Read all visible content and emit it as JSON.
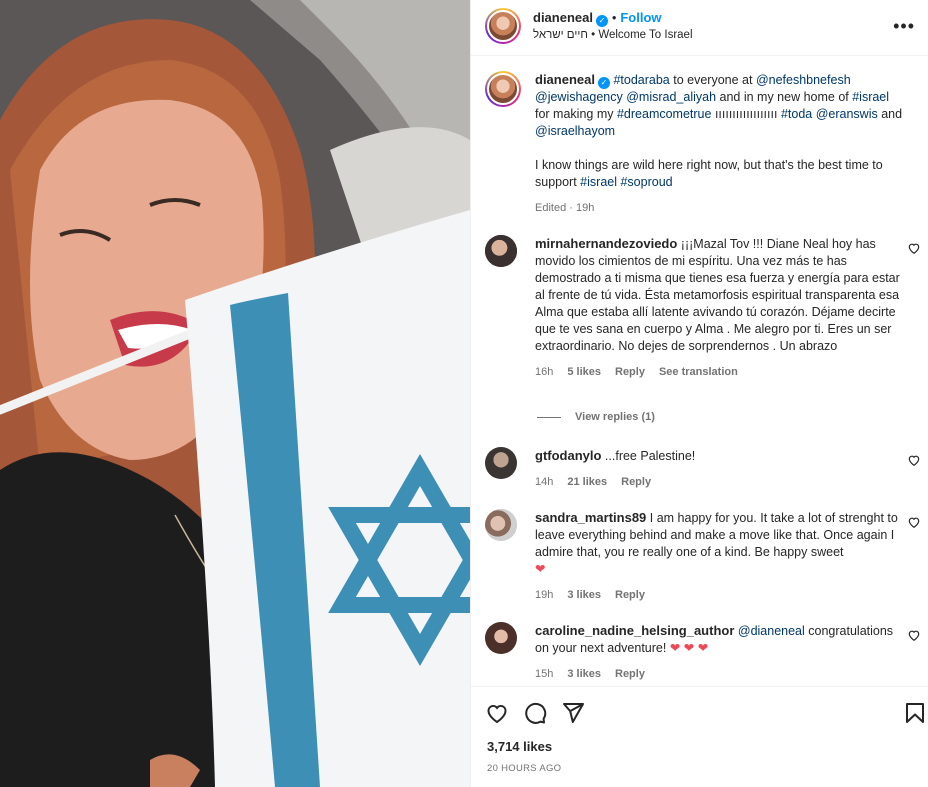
{
  "header": {
    "username": "dianeneal",
    "follow_label": "Follow",
    "location": "חיים ישראל • Welcome To Israel",
    "more_label": "•••"
  },
  "caption": {
    "username": "dianeneal",
    "parts": [
      {
        "t": "#todaraba",
        "tag": true
      },
      {
        "t": " to everyone at ",
        "tag": false
      },
      {
        "t": "@nefeshbnefesh",
        "tag": true
      },
      {
        "t": " ",
        "tag": false
      },
      {
        "t": "@jewishagency",
        "tag": true
      },
      {
        "t": " ",
        "tag": false
      },
      {
        "t": "@misrad_aliyah",
        "tag": true
      },
      {
        "t": " and in my new home of ",
        "tag": false
      },
      {
        "t": "#israel",
        "tag": true
      },
      {
        "t": " for making my ",
        "tag": false
      },
      {
        "t": "#dreamcometrue",
        "tag": true
      },
      {
        "t": " ıııııııııııııııııı ",
        "tag": false
      },
      {
        "t": "#toda",
        "tag": true
      },
      {
        "t": " ",
        "tag": false
      },
      {
        "t": "@eranswis",
        "tag": true
      },
      {
        "t": " and ",
        "tag": false
      },
      {
        "t": "@israelhayom",
        "tag": true
      }
    ],
    "second_parts": [
      {
        "t": "I know things are wild here right now, but that's the best time to support ",
        "tag": false
      },
      {
        "t": "#israel",
        "tag": true
      },
      {
        "t": " ",
        "tag": false
      },
      {
        "t": "#soproud",
        "tag": true
      }
    ],
    "meta": "Edited · 19h"
  },
  "comments": [
    {
      "username": "mirnahernandezoviedo",
      "text": "¡¡¡Mazal Tov !!! Diane Neal hoy has movido los cimientos de mi espíritu. Una vez más te has demostrado a ti misma que tienes esa fuerza y energía para estar al frente de tú vida. Ésta metamorfosis espiritual transparenta esa Alma que estaba allí latente avivando tú corazón. Déjame decirte que te ves sana en cuerpo y Alma . Me alegro por ti. Eres un ser extraordinario. No dejes de sorprendernos . Un abrazo",
      "time": "16h",
      "likes": "5 likes",
      "reply": "Reply",
      "translate": "See translation"
    },
    {
      "username": "gtfodanylo",
      "text": "...free Palestine!",
      "time": "14h",
      "likes": "21 likes",
      "reply": "Reply"
    },
    {
      "username": "sandra_martins89",
      "text": "I am happy for you. It take a lot of strenght to leave everything behind and make a move like that. Once again I admire that, you re really one of a kind. Be happy sweet",
      "hearts": "❤",
      "time": "19h",
      "likes": "3 likes",
      "reply": "Reply"
    },
    {
      "username": "caroline_nadine_helsing_author",
      "mention": "@dianeneal",
      "text": " congratulations on your next adventure! ",
      "hearts": "❤ ❤ ❤",
      "time": "15h",
      "likes": "3 likes",
      "reply": "Reply"
    }
  ],
  "view_replies": "View replies (1)",
  "footer": {
    "likes": "3,714 likes",
    "time_ago": "20 HOURS AGO"
  },
  "icons": {
    "like": "heart-icon",
    "comment": "comment-icon",
    "share": "share-icon",
    "save": "bookmark-icon"
  },
  "colors": {
    "link": "#0095f6",
    "tag": "#00376b",
    "muted": "#737373",
    "flag_blue": "#3d8fb5"
  }
}
